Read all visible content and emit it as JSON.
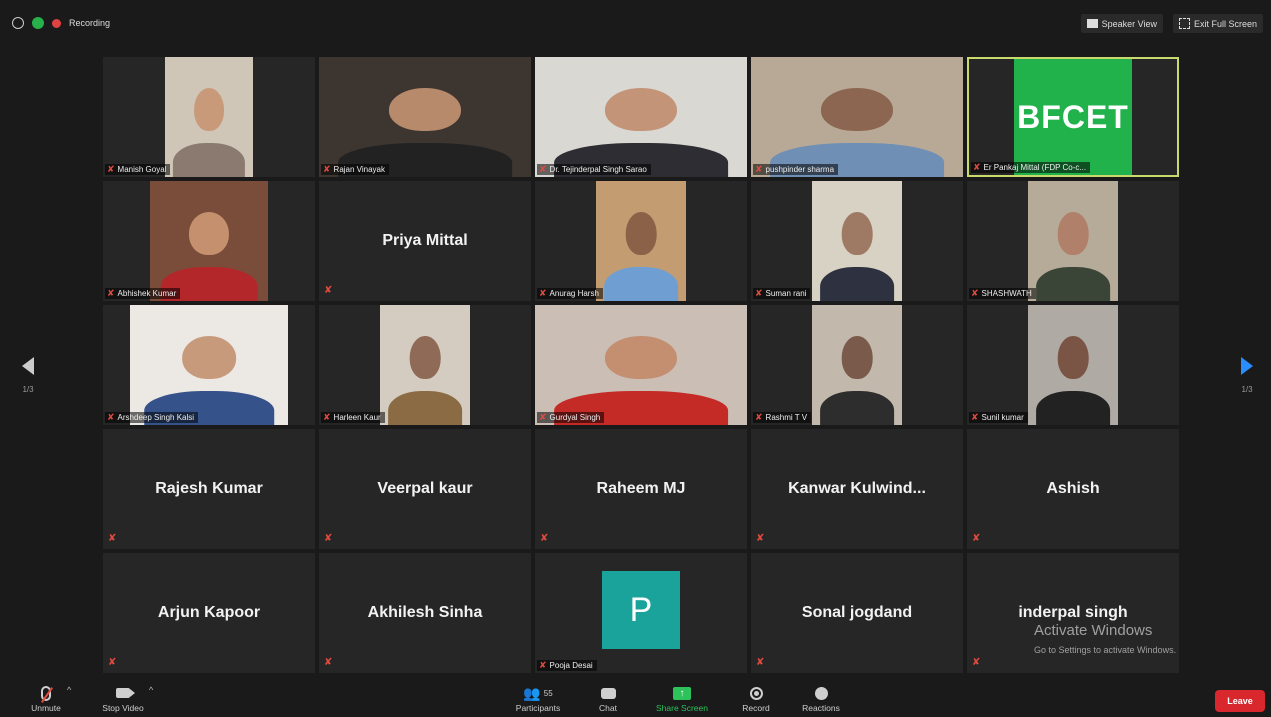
{
  "topbar": {
    "recording_label": "Recording",
    "speaker_view_label": "Speaker View",
    "exit_fullscreen_label": "Exit Full Screen"
  },
  "participants": [
    {
      "name": "Manish Goyal",
      "type": "video",
      "bg": "#cfc6b8",
      "head": "#c99a7a",
      "body": "#8a7a70",
      "vw": 88
    },
    {
      "name": "Rajan Vinayak",
      "type": "video",
      "bg": "#3d3530",
      "head": "#b88a6c",
      "body": "#222",
      "vw": 212
    },
    {
      "name": "Dr. Tejinderpal Singh Sarao",
      "type": "video",
      "bg": "#d9d8d3",
      "head": "#c49478",
      "body": "#2d2d33",
      "vw": 212
    },
    {
      "name": "pushpinder sharma",
      "type": "video",
      "bg": "#b8a996",
      "head": "#8c6650",
      "body": "#6f8fb4",
      "vw": 212
    },
    {
      "name": "Er Pankaj Mittal (FDP Co-c...",
      "type": "logo",
      "logo": "BFCET",
      "active": true
    },
    {
      "name": "Abhishek Kumar",
      "type": "video",
      "bg": "#7a4d3a",
      "head": "#c4906e",
      "body": "#b3272b",
      "vw": 118
    },
    {
      "name": "Priya Mittal",
      "type": "name"
    },
    {
      "name": "Anurag Harsh",
      "type": "video",
      "bg": "#c39c72",
      "head": "#8b6248",
      "body": "#6f9fd2",
      "vw": 90
    },
    {
      "name": "Suman rani",
      "type": "video",
      "bg": "#d8d2c4",
      "head": "#9e7a64",
      "body": "#2d3140",
      "vw": 90
    },
    {
      "name": "SHASHWATH",
      "type": "video",
      "bg": "#b5ab98",
      "head": "#b0806a",
      "body": "#3a4538",
      "vw": 90
    },
    {
      "name": "Arshdeep Singh Kalsi",
      "type": "video",
      "bg": "#ece8e4",
      "head": "#c89a7c",
      "body": "#36528a",
      "vw": 158
    },
    {
      "name": "Harleen Kaur",
      "type": "video",
      "bg": "#d4ccc0",
      "head": "#8f6a56",
      "body": "#8a6b44",
      "vw": 90
    },
    {
      "name": "Gurdyal Singh",
      "type": "video",
      "bg": "#cbbfb5",
      "head": "#c48e70",
      "body": "#c42a26",
      "vw": 212
    },
    {
      "name": "Rashmi T V",
      "type": "video",
      "bg": "#c2b8ac",
      "head": "#7a5a4a",
      "body": "#2d2d2d",
      "vw": 90
    },
    {
      "name": "Sunil kumar",
      "type": "video",
      "bg": "#b0aaa4",
      "head": "#7a5444",
      "body": "#222",
      "vw": 90
    },
    {
      "name": "Rajesh Kumar",
      "type": "name"
    },
    {
      "name": "Veerpal kaur",
      "type": "name"
    },
    {
      "name": "Raheem MJ",
      "type": "name"
    },
    {
      "name": "Kanwar  Kulwind...",
      "type": "name"
    },
    {
      "name": "Ashish",
      "type": "name"
    },
    {
      "name": "Arjun Kapoor",
      "type": "name"
    },
    {
      "name": "Akhilesh Sinha",
      "type": "name"
    },
    {
      "name": "Pooja Desai",
      "type": "avatar",
      "initial": "P"
    },
    {
      "name": "Sonal jogdand",
      "type": "name"
    },
    {
      "name": "inderpal singh",
      "type": "name"
    }
  ],
  "nav": {
    "page_left": "1/3",
    "page_right": "1/3"
  },
  "watermark": {
    "line1": "Activate Windows",
    "line2": "Go to Settings to activate Windows."
  },
  "toolbar": {
    "unmute": "Unmute",
    "stop_video": "Stop Video",
    "participants": "Participants",
    "participants_count": "55",
    "chat": "Chat",
    "share_screen": "Share Screen",
    "record": "Record",
    "reactions": "Reactions",
    "leave": "Leave"
  }
}
